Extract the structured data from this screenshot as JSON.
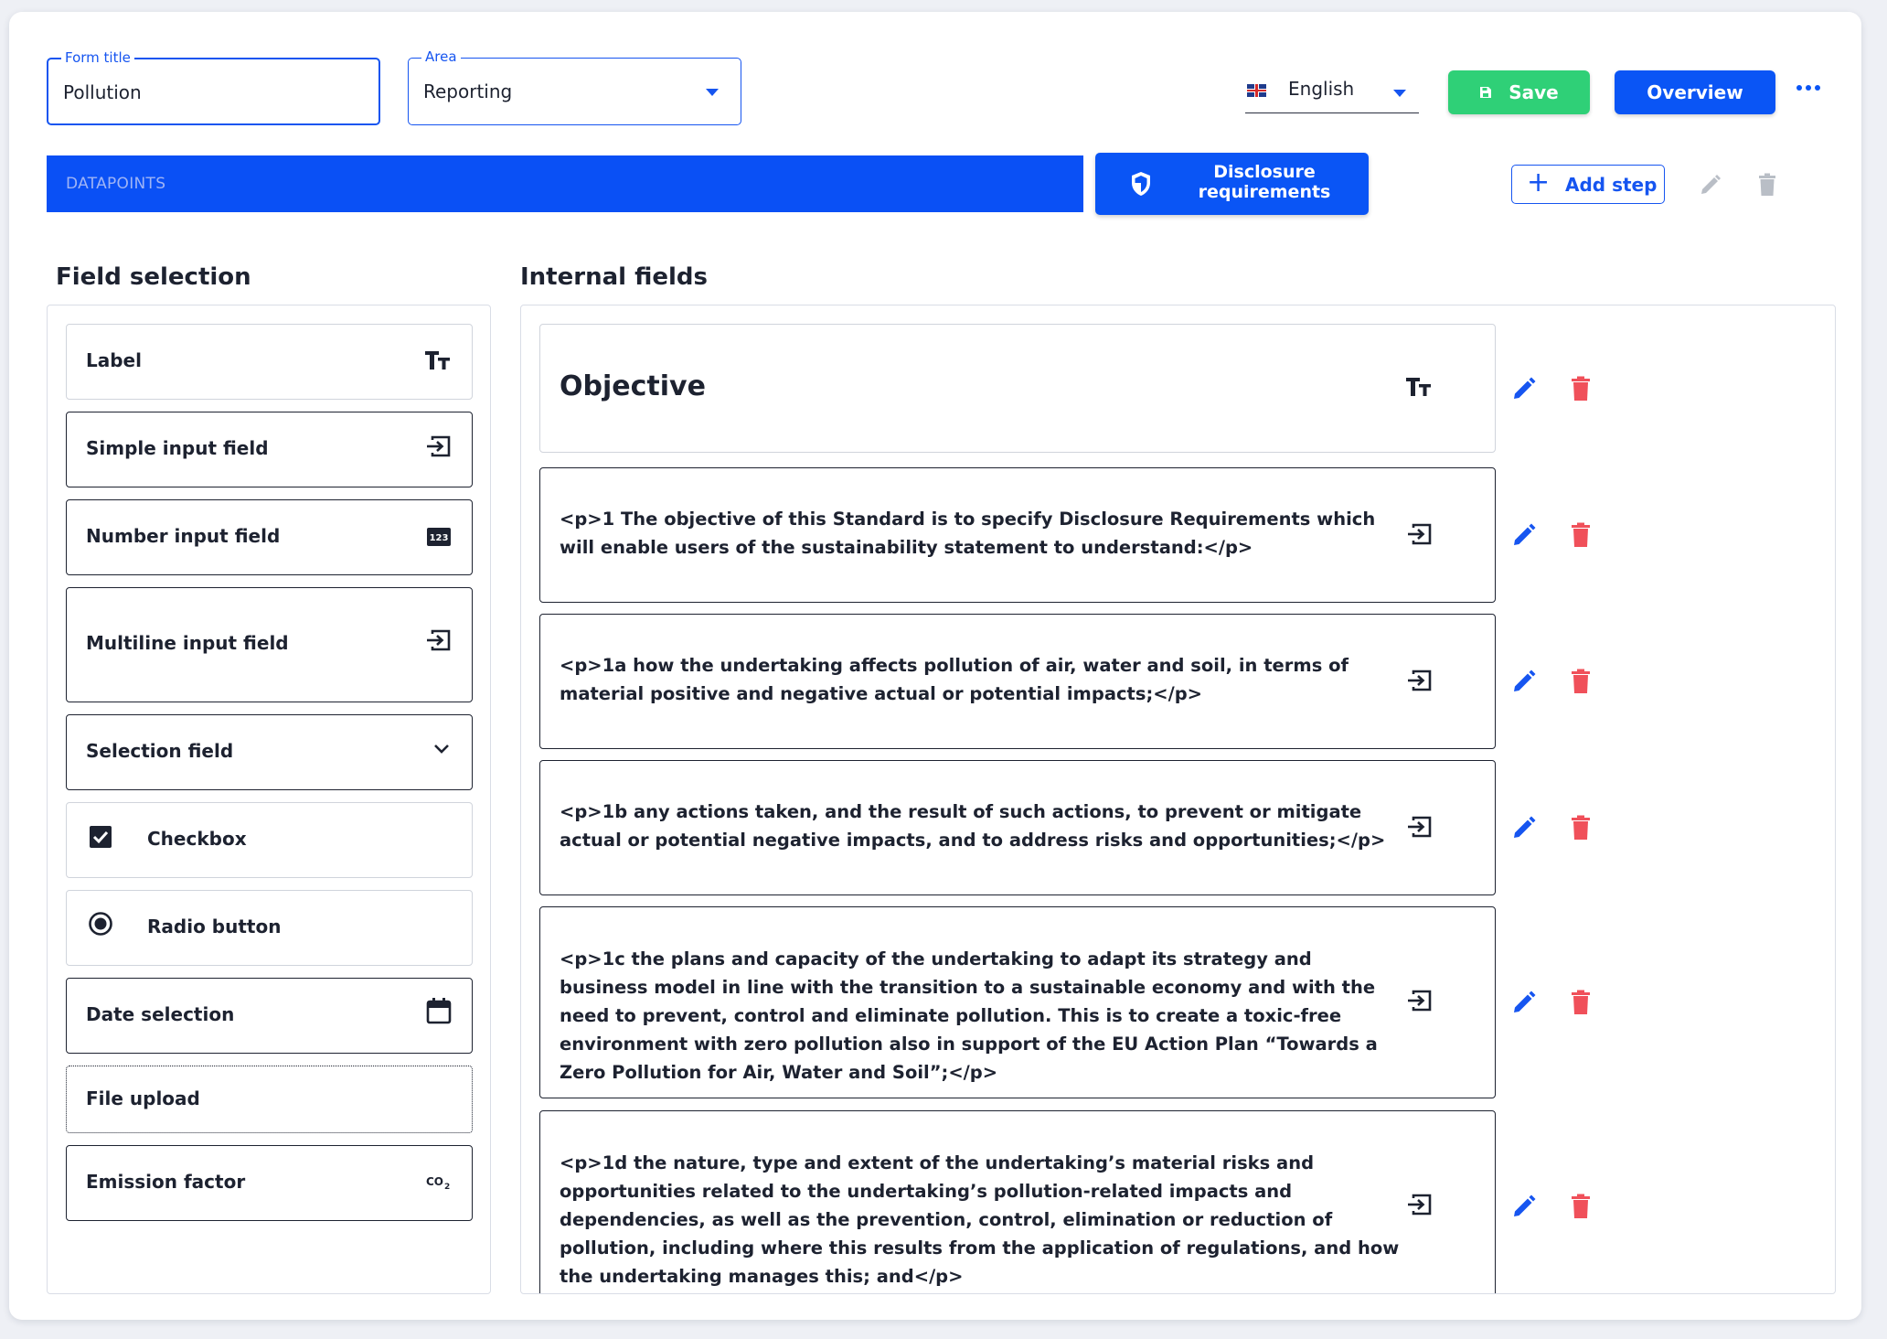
{
  "header": {
    "form_title": {
      "legend": "Form title",
      "value": "Pollution"
    },
    "area": {
      "legend": "Area",
      "value": "Reporting"
    },
    "language": {
      "value": "English",
      "flag_icon": "uk-flag-icon"
    },
    "save_label": "Save",
    "overview_label": "Overview",
    "more_icon": "more-horizontal-icon"
  },
  "tabs": {
    "active_tab": "DATAPOINTS",
    "disclosure_label": "Disclosure requirements",
    "add_step_label": "Add step"
  },
  "field_selection": {
    "heading": "Field selection",
    "items": [
      {
        "label": "Label",
        "icon": "text-size-icon"
      },
      {
        "label": "Simple input field",
        "icon": "input-icon"
      },
      {
        "label": "Number input field",
        "icon": "numeric-123-icon"
      },
      {
        "label": "Multiline input field",
        "icon": "input-icon"
      },
      {
        "label": "Selection field",
        "icon": "chevron-down-icon"
      },
      {
        "label": "Checkbox",
        "icon": "checkbox-checked-icon"
      },
      {
        "label": "Radio button",
        "icon": "radio-selected-icon"
      },
      {
        "label": "Date selection",
        "icon": "calendar-icon"
      },
      {
        "label": "File upload",
        "icon": ""
      },
      {
        "label": "Emission factor",
        "icon": "co2-icon"
      }
    ]
  },
  "internal_fields": {
    "heading": "Internal fields",
    "items": [
      {
        "text": "Objective",
        "icon": "text-size-icon"
      },
      {
        "text": "<p>1 The objective of this Standard is to specify Disclosure Requirements which will enable users of the sustainability statement to understand:</p>",
        "icon": "input-icon"
      },
      {
        "text": "<p>1a how the undertaking affects pollution of air, water and soil, in terms of material positive and negative actual or potential impacts;</p>",
        "icon": "input-icon"
      },
      {
        "text": "<p>1b any actions taken, and the result of such actions, to prevent or mitigate actual or potential negative impacts, and to address risks and opportunities;</p>",
        "icon": "input-icon"
      },
      {
        "text": "<p>1c the plans and capacity of the undertaking to adapt its strategy and business model in line with the transition to a sustainable economy and with the need to prevent, control and eliminate pollution. This is to create a toxic-free environment with zero pollution also in support of the EU Action Plan “Towards a Zero Pollution for Air, Water and Soil”;</p>",
        "icon": "input-icon"
      },
      {
        "text": "<p>1d the nature, type and extent of the undertaking’s material risks and opportunities related to the undertaking’s pollution-related impacts and dependencies, as well as the prevention, control, elimination or reduction of pollution, including where this results from the application of regulations, and how the undertaking manages this; and</p>",
        "icon": "input-icon"
      }
    ]
  },
  "colors": {
    "primary": "#0a55f5",
    "save_green": "#2fd077",
    "delete_red": "#f0505a",
    "muted_gray": "#9aa0a8"
  }
}
